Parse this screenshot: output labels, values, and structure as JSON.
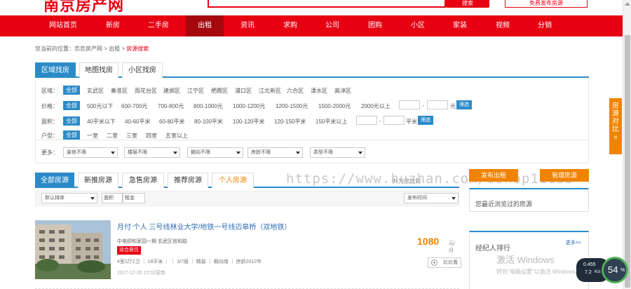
{
  "header": {
    "logo_text": "南京房产网",
    "search_button": "搜索",
    "publish_button": "免费发布房源"
  },
  "nav": {
    "items": [
      "网站首页",
      "新房",
      "二手房",
      "出租",
      "资讯",
      "求购",
      "公司",
      "团购",
      "小区",
      "家装",
      "视频",
      "分销"
    ],
    "active": "出租"
  },
  "breadcrumb": {
    "prefix": "您当前的位置：",
    "site": "恋恋房产网",
    "sep1": " > ",
    "section": "出租",
    "sep2": " > ",
    "current": "房源搜索"
  },
  "search_tabs": [
    "区域找房",
    "地图找房",
    "小区找房"
  ],
  "filters": {
    "area": {
      "label": "区域：",
      "all": "全部",
      "options": [
        "玄武区",
        "秦淮区",
        "雨花台区",
        "建邺区",
        "江宁区",
        "栖霞区",
        "浦口区",
        "江北新区",
        "六合区",
        "溧水区",
        "高淳区"
      ]
    },
    "price": {
      "label": "价格：",
      "all": "全部",
      "options": [
        "500元以下",
        "600-700元",
        "700-800元",
        "800-1000元",
        "1000-1200元",
        "1200-1500元",
        "1500-2000元",
        "2000元以上"
      ],
      "dash": "-",
      "unit": "元",
      "submit": "筛选"
    },
    "size": {
      "label": "面积：",
      "all": "全部",
      "options": [
        "40平米以下",
        "40-60平米",
        "60-80平米",
        "80-100平米",
        "100-120平米",
        "120-150平米",
        "150平米以上"
      ],
      "dash": "-",
      "unit": "平米",
      "submit": "筛选"
    },
    "layout": {
      "label": "户型：",
      "all": "全部",
      "options": [
        "一室",
        "二室",
        "三室",
        "四室",
        "五室以上"
      ]
    },
    "more": {
      "label": "更多：",
      "selects": [
        "装修不限",
        "楼层不限",
        "朝向不限",
        "房龄不限",
        "类型不限"
      ]
    }
  },
  "list_tabs": {
    "items": [
      "全部房源",
      "新推房源",
      "急售房源",
      "推荐房源",
      "个人房源"
    ],
    "active": "全部房源",
    "count_prefix": "共为您找到",
    "count_suffix": "套房源"
  },
  "watermark": "https://www.huzhan.com/ishop11135",
  "sortbar": {
    "default_sort": "默认排序",
    "area": "面积",
    "rent": "租金",
    "time_sort": "发布时间"
  },
  "listing": {
    "title": "月付 个人 三号线林业大学/地铁一号线迈皋桥（双地铁）",
    "subtitle": "中电颐和家园一期 玄武区宫和路",
    "badge": "适合居住",
    "attrs": "4室1厅2卫 ｜ 18平米 ｜ ｜ 3/7层 ｜ 精装 ｜ 朝向南 ｜ 房龄2012年",
    "date": "2017-12-25 22:02更新",
    "price": "1080",
    "price_unit": "元/月",
    "compare": "比比看"
  },
  "sidebar": {
    "publish_rent": "发布出租",
    "manage": "管理房源",
    "recent_title": "您最近浏览过的房源",
    "agent_title": "经纪人排行",
    "agent_more": "更多>>"
  },
  "float_tab": {
    "text": "房源对比",
    "arrow": "«"
  },
  "os_overlay": {
    "activate_title": "激活 Windows",
    "activate_sub": "转到\"电脑设置\"以激活 Windows。",
    "net_up": "0.455",
    "net_down": "7.2",
    "net_unit": "K/s",
    "cpu": "54",
    "cpu_unit": "%"
  },
  "colors": {
    "brand_red": "#e60012",
    "nav_active": "#a5090d",
    "accent_blue": "#2b8bc9",
    "accent_orange": "#f08300"
  }
}
